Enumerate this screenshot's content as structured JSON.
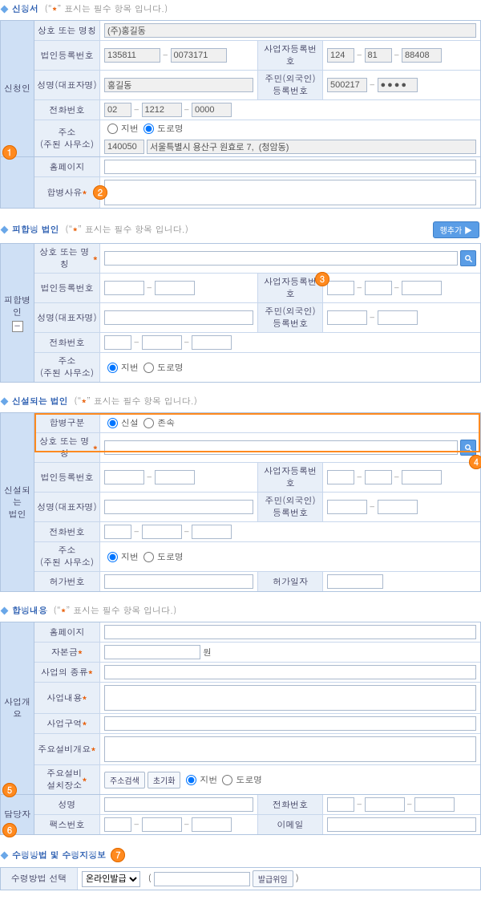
{
  "sections": {
    "s1": {
      "title": "신청서",
      "note": "(\"*\" 표시는 필수 항목 입니다.)"
    },
    "s2": {
      "title": "피합병 법인",
      "note": "(\"*\" 표시는 필수 항목 입니다.)",
      "add_btn": "행추가 ▶"
    },
    "s3": {
      "title": "신설되는 법인",
      "note": "(\"*\" 표시는 필수 항목 입니다.)"
    },
    "s4": {
      "title": "합병내용",
      "note": "(\"*\" 표시는 필수 항목 입니다.)"
    },
    "s5": {
      "title": "수령방법 및 수령지정보"
    }
  },
  "labels": {
    "company_name": "상호 또는 명칭",
    "corp_reg_no": "법인등록번호",
    "biz_reg_no": "사업자등록번호",
    "ceo_name": "성명(대표자명)",
    "rrn": "주민(외국인)\n등록번호",
    "phone": "전화번호",
    "address": "주소\n(주된 사무소)",
    "homepage": "홈페이지",
    "merge_reason": "합병사유",
    "merge_type": "합병구분",
    "permit_no": "허가번호",
    "permit_date": "허가일자",
    "capital": "자본금",
    "capital_unit": "원",
    "biz_type": "사업의 종류",
    "biz_content": "사업내용",
    "biz_area": "사업구역",
    "facility_overview": "주요설비개요",
    "facility_location": "주요설비\n설치장소",
    "name": "성명",
    "fax": "팩스번호",
    "email": "이메일",
    "recv_method": "수령방법 선택",
    "addr_search": "주소검색",
    "reset": "초기화",
    "issue_confirm": "발급위임",
    "merge_type_new": "신설",
    "merge_type_cont": "존속"
  },
  "radio": {
    "jibun": "지번",
    "road": "도로명"
  },
  "sidebar": {
    "applicant": "신청인",
    "merged": "피합병인",
    "new_corp": "신설되는\n법인",
    "biz_overview": "사업개요",
    "contact": "담당자"
  },
  "applicant": {
    "company_name": "(주)홍길동",
    "corp_no_1": "135811",
    "corp_no_2": "0073171",
    "biz_no_1": "124",
    "biz_no_2": "81",
    "biz_no_3": "88408",
    "ceo": "홍길동",
    "rrn_1": "500217",
    "rrn_2": "●●●●",
    "tel_1": "02",
    "tel_2": "1212",
    "tel_3": "0000",
    "zip": "140050",
    "addr": "서울특별시 용산구 원효로 7,  (청암동)"
  },
  "recv": {
    "method": "온라인발급",
    "paren_open": "(",
    "paren_close": ")"
  },
  "markers": {
    "m1": "1",
    "m2": "2",
    "m3": "3",
    "m4": "4",
    "m5": "5",
    "m6": "6",
    "m7": "7"
  },
  "icons": {
    "minus": "−"
  }
}
